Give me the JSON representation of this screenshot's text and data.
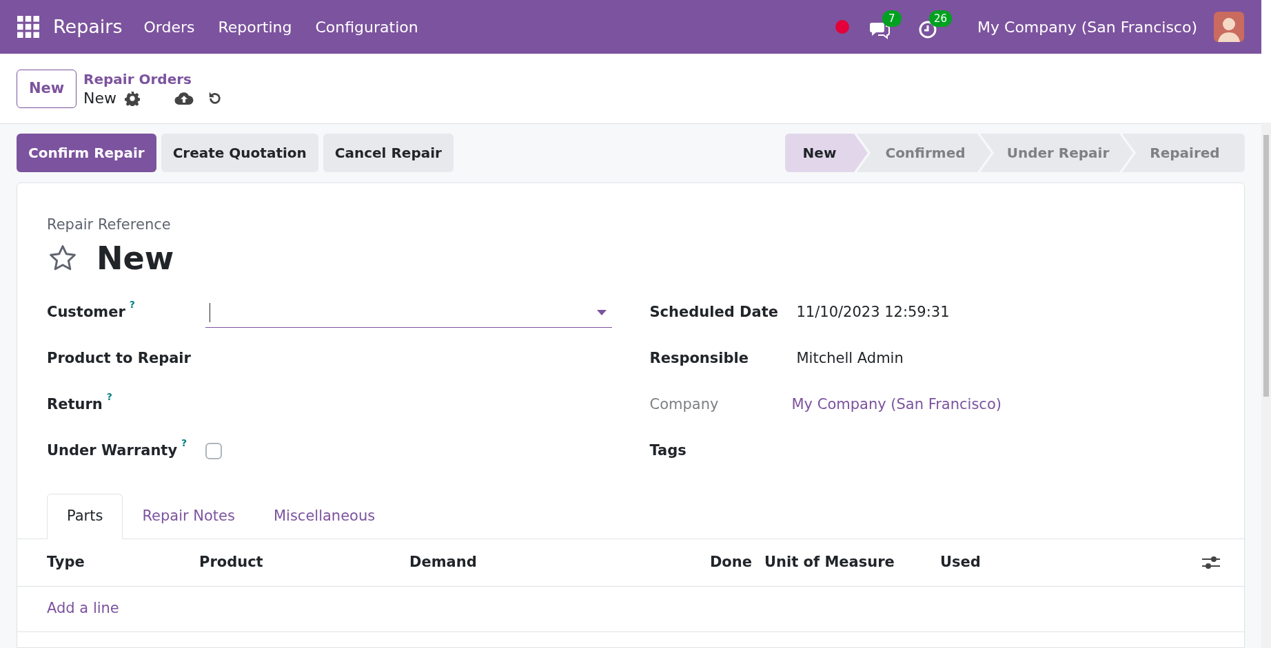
{
  "navbar": {
    "app": "Repairs",
    "menu": [
      "Orders",
      "Reporting",
      "Configuration"
    ],
    "messages_count": "7",
    "activities_count": "26",
    "company": "My Company (San Francisco)"
  },
  "control_panel": {
    "new_button": "New",
    "breadcrumb": "Repair Orders",
    "record": "New"
  },
  "actions": [
    {
      "label": "Confirm Repair",
      "kind": "primary"
    },
    {
      "label": "Create Quotation",
      "kind": "secondary"
    },
    {
      "label": "Cancel Repair",
      "kind": "secondary"
    }
  ],
  "stages": [
    {
      "label": "New",
      "selected": true
    },
    {
      "label": "Confirmed",
      "selected": false
    },
    {
      "label": "Under Repair",
      "selected": false
    },
    {
      "label": "Repaired",
      "selected": false
    }
  ],
  "form": {
    "reference_label": "Repair Reference",
    "title": "New",
    "starred": false,
    "left_fields": [
      {
        "label": "Customer",
        "help": "?",
        "kind": "dropdown"
      },
      {
        "label": "Product to Repair",
        "kind": "empty"
      },
      {
        "label": "Return",
        "help": "?",
        "kind": "empty"
      },
      {
        "label": "Under Warranty",
        "help": "?",
        "kind": "checkbox",
        "checked": false
      }
    ],
    "right_fields": [
      {
        "label": "Scheduled Date",
        "value": "11/10/2023 12:59:31",
        "kind": "text"
      },
      {
        "label": "Responsible",
        "value": "Mitchell Admin",
        "kind": "text"
      },
      {
        "label": "Company",
        "value": "My Company (San Francisco)",
        "kind": "link",
        "muted": true
      },
      {
        "label": "Tags",
        "kind": "empty"
      }
    ]
  },
  "tabs": [
    {
      "label": "Parts",
      "selected": true
    },
    {
      "label": "Repair Notes",
      "selected": false
    },
    {
      "label": "Miscellaneous",
      "selected": false
    }
  ],
  "table": {
    "columns": [
      "Type",
      "Product",
      "Demand",
      "Done",
      "Unit of Measure",
      "Used"
    ],
    "add_line": "Add a line"
  }
}
